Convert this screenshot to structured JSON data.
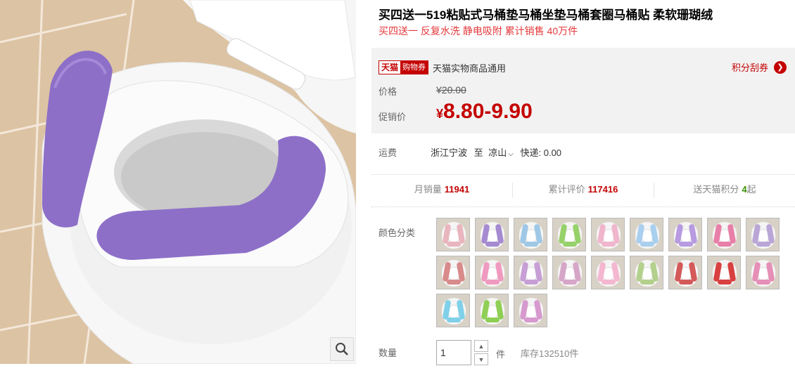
{
  "product": {
    "title": "买四送一519粘贴式马桶垫马桶坐垫马桶套圈马桶贴 柔软珊瑚绒",
    "subtitle": "买四送一 反复水洗 静电吸附 累计销售 40万件"
  },
  "coupon": {
    "badge_brand": "天猫",
    "badge_type": "购物券",
    "text": "天猫实物商品通用",
    "points_link": "积分刮券",
    "arrow_icon": "chevron-right-icon"
  },
  "price": {
    "label": "价格",
    "original": "¥20.00",
    "promo_label": "促销价",
    "promo_symbol": "¥",
    "promo_value": "8.80-9.90"
  },
  "shipping": {
    "label": "运费",
    "from": "浙江宁波",
    "to_prefix": "至",
    "destination": "凉山",
    "dropdown_icon": "chevron-down-icon",
    "express": "快递: 0.00"
  },
  "stats": {
    "monthly_sales_label": "月销量",
    "monthly_sales": "11941",
    "reviews_label": "累计评价",
    "reviews": "117416",
    "points_label": "送天猫积分",
    "points": "4",
    "points_suffix": "起"
  },
  "colors": {
    "label": "颜色分类",
    "swatch_colors": [
      "#e9b5be",
      "#a58ad1",
      "#9fc8e6",
      "#97d16a",
      "#f0b6cc",
      "#a9cfee",
      "#b79ae0",
      "#e87fa8",
      "#b9a6d6",
      "#d98a8a",
      "#f09ac0",
      "#c79fd5",
      "#d6a6c8",
      "#f4b7cf",
      "#b3d08c",
      "#d45a5a",
      "#d94040",
      "#e58fb6",
      "#7fd0e8",
      "#8fcf55",
      "#d79acf"
    ]
  },
  "quantity": {
    "label": "数量",
    "value": "1",
    "unit": "件",
    "stock": "库存132510件",
    "up_icon": "chevron-up-icon",
    "down_icon": "chevron-down-icon"
  },
  "image": {
    "zoom_icon": "magnifier-icon"
  }
}
